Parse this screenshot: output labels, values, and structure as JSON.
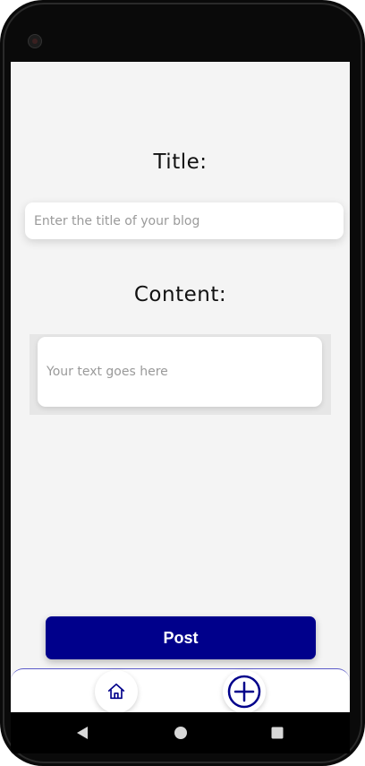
{
  "form": {
    "title_label": "Title:",
    "title_placeholder": "Enter the title of your blog",
    "content_label": "Content:",
    "content_placeholder": "Your text goes here",
    "post_label": "Post"
  },
  "bottom_nav": {
    "items": [
      {
        "icon": "home-icon"
      },
      {
        "icon": "add-circle-icon"
      }
    ]
  },
  "system_nav": {
    "icons": [
      "back-icon",
      "home-circle-icon",
      "recents-icon"
    ]
  },
  "colors": {
    "accent": "#00008b",
    "background": "#f4f4f4",
    "placeholder": "#9a9a9a",
    "nav_border": "#5a5ac8"
  }
}
